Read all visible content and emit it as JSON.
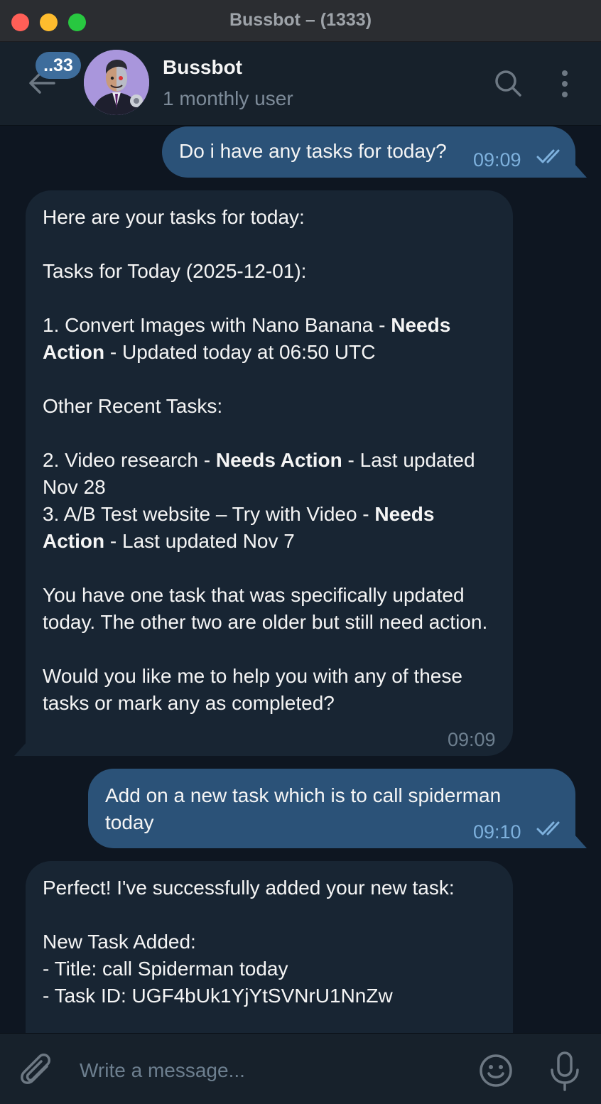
{
  "window": {
    "title": "Bussbot – (1333)"
  },
  "header": {
    "unread_badge": "..33",
    "name": "Bussbot",
    "status": "1 monthly user"
  },
  "messages": [
    {
      "direction": "outgoing",
      "text": "Do i have any tasks for today?",
      "time": "09:09",
      "read": true
    },
    {
      "direction": "incoming",
      "lines": {
        "l1": "Here are your tasks for today:",
        "l2": "Tasks for Today (2025-12-01):",
        "l3a": "1. Convert Images with Nano Banana - ",
        "l3b": "Needs Action",
        "l3c": " - Updated today at 06:50 UTC",
        "l4": "Other Recent Tasks:",
        "l5a": "2. Video research - ",
        "l5b": "Needs Action",
        "l5c": " - Last updated Nov 28",
        "l6a": "3. A/B Test website – Try with Video - ",
        "l6b": "Needs Action",
        "l6c": " - Last updated Nov 7",
        "l7": "You have one task that was specifically updated today. The other two are older but still need action.",
        "l8": "Would you like me to help you with any of these tasks or mark any as completed?"
      },
      "time": "09:09"
    },
    {
      "direction": "outgoing",
      "text": "Add on a new task which is to call spiderman today",
      "time": "09:10",
      "read": true
    },
    {
      "direction": "incoming",
      "lines": {
        "l1": "Perfect! I've successfully added your new task:",
        "l2": "New Task Added:",
        "l3": "- Title: call Spiderman today",
        "l4": "- Task ID: UGF4bUk1YjYtSVNrU1NnZw"
      }
    }
  ],
  "composer": {
    "placeholder": "Write a message..."
  },
  "icons": [
    "back-arrow-icon",
    "search-icon",
    "more-vertical-icon",
    "double-check-icon",
    "paperclip-icon",
    "emoji-icon",
    "microphone-icon"
  ],
  "colors": {
    "background": "#0e1621",
    "header": "#17212b",
    "outgoing_bubble": "#2b5278",
    "incoming_bubble": "#182533",
    "accent": "#3e6d9c",
    "outgoing_time": "#7eb1dd"
  }
}
